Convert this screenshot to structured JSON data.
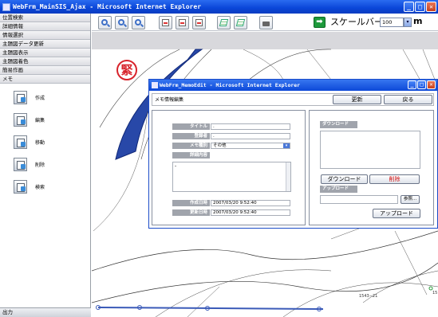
{
  "window": {
    "title": "WebFrm_MainSIS_Ajax - Microsoft Internet Explorer",
    "minimize_glyph": "_",
    "maximize_glyph": "□",
    "close_glyph": "✕"
  },
  "sidebar": {
    "menu": [
      {
        "label": "位置検索"
      },
      {
        "label": "詳細情報"
      },
      {
        "label": "情報選択"
      },
      {
        "label": "主題図データ更新"
      },
      {
        "label": "主題図表示"
      },
      {
        "label": "主題図着色"
      },
      {
        "label": "簡易作画"
      },
      {
        "label": "メモ"
      }
    ],
    "tools": [
      {
        "label": "作成",
        "icon": "memo-create-icon"
      },
      {
        "label": "編集",
        "icon": "memo-edit-icon"
      },
      {
        "label": "移動",
        "icon": "memo-move-icon"
      },
      {
        "label": "削除",
        "icon": "memo-delete-icon"
      },
      {
        "label": "検索",
        "icon": "memo-search-icon"
      }
    ],
    "output_label": "出力"
  },
  "toolbar": {
    "buttons": [
      "select-icon",
      "zoom-in-icon",
      "zoom-out-icon",
      "page-icon-1",
      "page-icon-2",
      "page-icon-3",
      "layer-icon-1",
      "layer-icon-2",
      "print-icon"
    ],
    "scale_arrow_glyph": "➡",
    "scale_label": "スケールバー",
    "scale_value": "100",
    "scale_unit": "m",
    "dropdown_glyph": "▾"
  },
  "map": {
    "stamp_text": "緊",
    "labels": [
      "1543−21",
      "15"
    ]
  },
  "popup": {
    "title": "WebFrm_MemoEdit - Microsoft Internet Explorer",
    "header_label": "メモ情報編集",
    "update_button": "更新",
    "back_button": "戻る",
    "fields": {
      "title_label": "タイトル",
      "title_value": ".",
      "registrant_label": "登録者",
      "registrant_value": ".",
      "type_label": "メモ種別",
      "type_value": "その他",
      "details_label": "詳細内容",
      "details_value": "-",
      "created_label": "作成日時",
      "created_value": "2007/03/20 9:52:40",
      "updated_label": "更新日時",
      "updated_value": "2007/03/20 9:52:40"
    },
    "download": {
      "section_label": "ダウンロード",
      "download_button": "ダウンロード",
      "delete_button": "削除"
    },
    "upload": {
      "section_label": "アップロード",
      "browse_button": "参照...",
      "upload_button": "アップロード"
    }
  },
  "colors": {
    "title_bar": "#0a46d8",
    "stamp": "#d8242c",
    "delete_text": "#d01010",
    "scale_arrow": "#1e9a3c"
  }
}
